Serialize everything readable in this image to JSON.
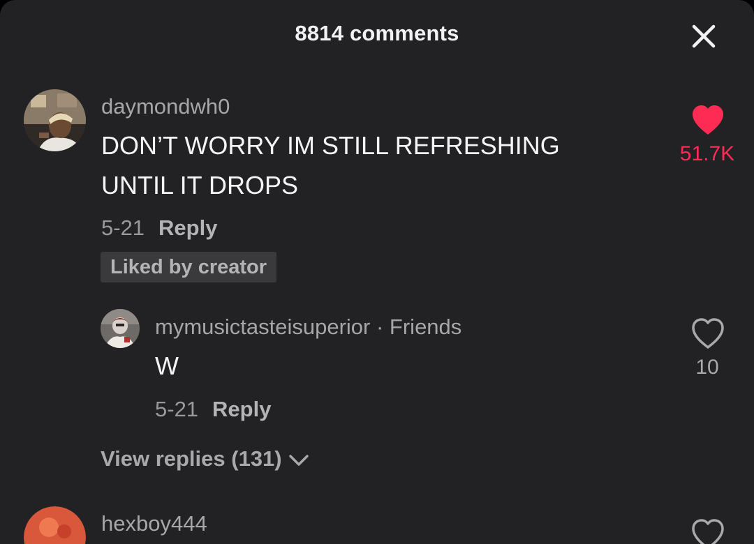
{
  "header": {
    "title": "8814 comments"
  },
  "colors": {
    "background": "#222224",
    "liked_accent": "#fe2c55",
    "muted_text": "#a7a7a9"
  },
  "icons": {
    "close": "close-icon",
    "like_filled": "heart-filled-icon",
    "like_outline": "heart-outline-icon",
    "expand": "chevron-down-icon"
  },
  "comments": [
    {
      "username": "daymondwh0",
      "text_lines": [
        "DON’T WORRY IM STILL REFRESHING",
        "UNTIL IT DROPS"
      ],
      "date": "5-21",
      "reply_label": "Reply",
      "badge": "Liked by creator",
      "likes": "51.7K",
      "liked": true,
      "replies": [
        {
          "username": "mymusictasteisuperior",
          "relation": " · Friends",
          "text": "W",
          "date": "5-21",
          "reply_label": "Reply",
          "likes": "10",
          "liked": false
        }
      ],
      "view_replies_label": "View replies (131)"
    },
    {
      "username": "hexboy444"
    }
  ]
}
